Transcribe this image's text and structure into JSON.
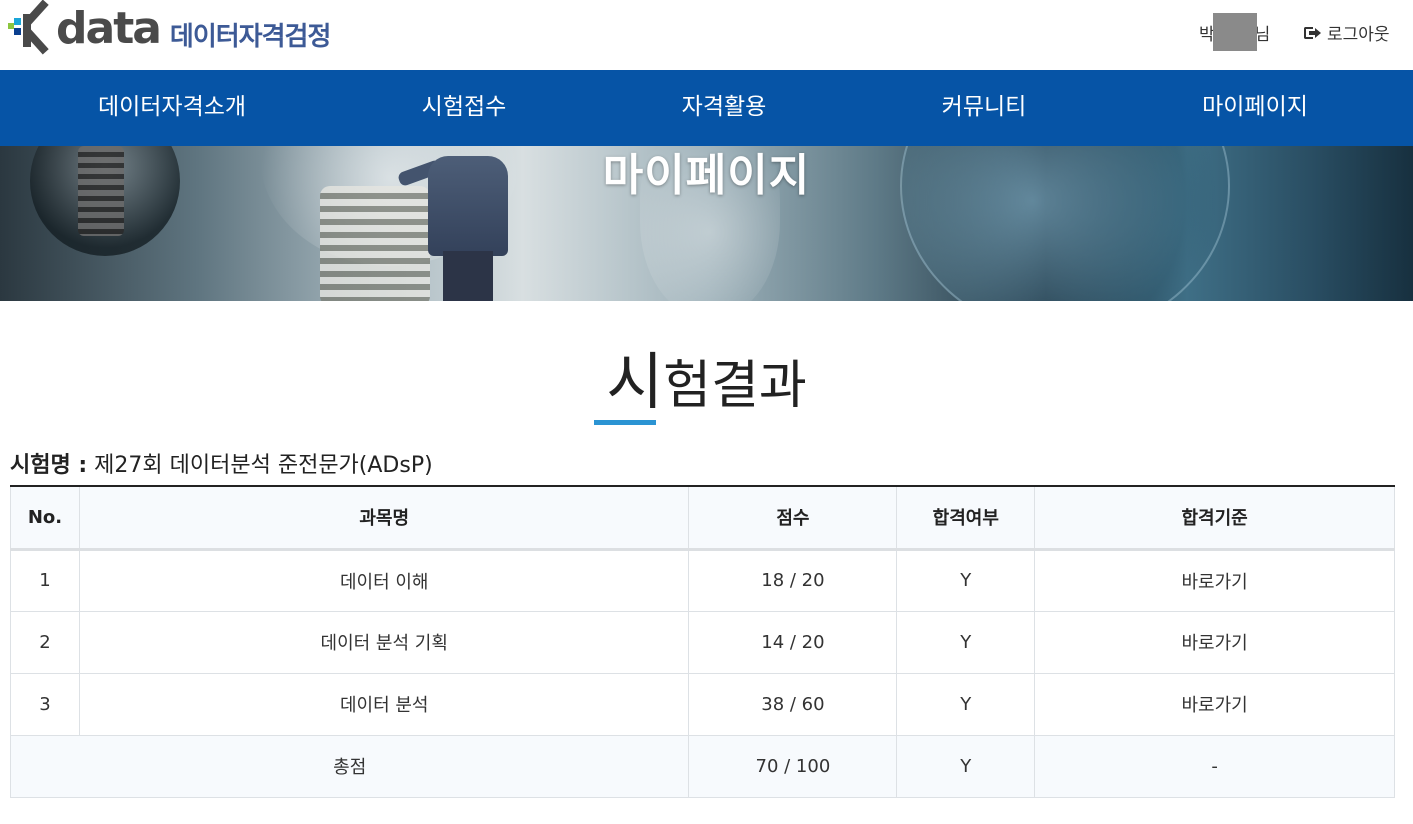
{
  "header": {
    "logo_text": "data",
    "logo_sub": "데이터자격검정",
    "user": {
      "name_first": "박",
      "name_suffix": "님"
    },
    "logout_label": "로그아웃"
  },
  "nav": {
    "items": [
      {
        "label": "데이터자격소개"
      },
      {
        "label": "시험접수"
      },
      {
        "label": "자격활용"
      },
      {
        "label": "커뮤니티"
      },
      {
        "label": "마이페이지"
      }
    ]
  },
  "banner": {
    "title": "마이페이지"
  },
  "page": {
    "title_first": "시",
    "title_rest": "험결과",
    "exam_label": "시험명 :",
    "exam_name": " 제27회 데이터분석 준전문가(ADsP)"
  },
  "table": {
    "headers": [
      "No.",
      "과목명",
      "점수",
      "합격여부",
      "합격기준"
    ],
    "rows": [
      {
        "no": "1",
        "subject": "데이터 이해",
        "score": "18 / 20",
        "pass": "Y",
        "criteria": "바로가기"
      },
      {
        "no": "2",
        "subject": "데이터 분석 기획",
        "score": "14 / 20",
        "pass": "Y",
        "criteria": "바로가기"
      },
      {
        "no": "3",
        "subject": "데이터 분석",
        "score": "38 / 60",
        "pass": "Y",
        "criteria": "바로가기"
      }
    ],
    "total": {
      "label": "총점",
      "score": "70 / 100",
      "pass": "Y",
      "criteria": "-"
    }
  },
  "colors": {
    "nav_bg": "#0654a6",
    "accent_underline": "#2b94d3",
    "logo_sub": "#3d5a96"
  }
}
